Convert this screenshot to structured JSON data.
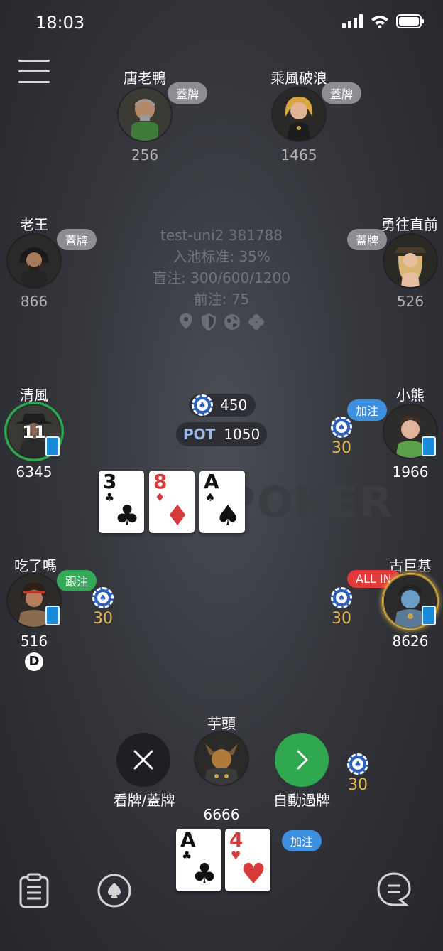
{
  "status_bar": {
    "time": "18:03"
  },
  "table_info": {
    "name": "test-uni2 381788",
    "entry_rate": "入池标准: 35%",
    "blinds": "盲注: 300/600/1200",
    "ante": "前注: 75"
  },
  "watermark": "POKER",
  "pot": {
    "round_bet": "450",
    "label": "POT",
    "total": "1050"
  },
  "community_cards": [
    {
      "rank": "3",
      "suit": "♣",
      "color": "black"
    },
    {
      "rank": "8",
      "suit": "♦",
      "color": "red"
    },
    {
      "rank": "A",
      "suit": "♠",
      "color": "black"
    }
  ],
  "players": {
    "p1": {
      "name": "唐老鴨",
      "stack": "256",
      "status": "蓋牌"
    },
    "p2": {
      "name": "乘風破浪",
      "stack": "1465",
      "status": "蓋牌"
    },
    "p3": {
      "name": "老王",
      "stack": "866",
      "status": "蓋牌"
    },
    "p4": {
      "name": "勇往直前",
      "stack": "526",
      "status": "蓋牌"
    },
    "p5": {
      "name": "清風",
      "stack": "6345",
      "timer": "11"
    },
    "p6": {
      "name": "小熊",
      "stack": "1966",
      "status": "加注",
      "bet": "30"
    },
    "p7": {
      "name": "吃了嗎",
      "stack": "516",
      "status": "跟注",
      "bet": "30",
      "dealer": "D"
    },
    "p8": {
      "name": "古巨基",
      "stack": "8626",
      "status": "ALL IN",
      "bet": "30"
    },
    "hero": {
      "name": "芋頭",
      "stack": "6666",
      "bet": "30",
      "status": "加注"
    }
  },
  "hero_cards": [
    {
      "rank": "A",
      "suit": "♣",
      "color": "black"
    },
    {
      "rank": "4",
      "suit": "♥",
      "color": "red"
    }
  ],
  "actions": {
    "fold_label": "看牌/蓋牌",
    "auto_check_label": "自動過牌"
  },
  "colors": {
    "raise": "#3d8fe0",
    "call": "#35a95a",
    "allin": "#e03a3a",
    "fold": "#8c8e93",
    "bet": "#e8b84a",
    "active_ring": "#2fa84f"
  },
  "icons": [
    "signal-icon",
    "wifi-icon",
    "battery-icon",
    "menu-icon",
    "location-icon",
    "shield-icon",
    "globe-icon",
    "clover-icon",
    "close-icon",
    "chevron-right-icon",
    "clipboard-icon",
    "spade-icon",
    "chat-icon"
  ]
}
